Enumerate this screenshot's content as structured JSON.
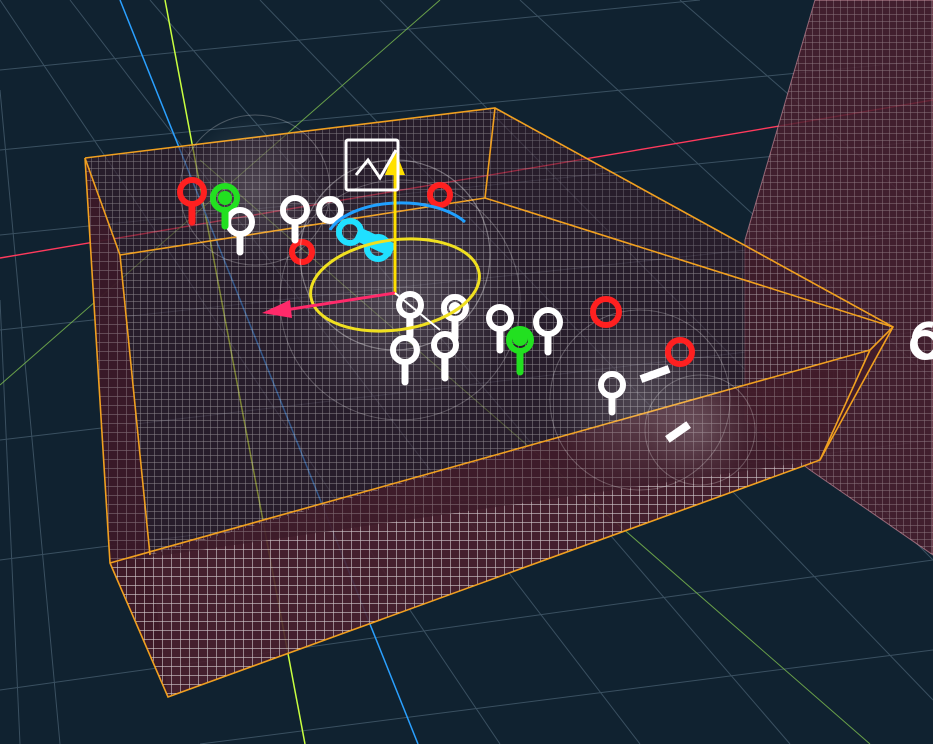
{
  "scene": {
    "type": "3d-editor-viewport",
    "background_color": "#102230",
    "grid_color": "#3f5566",
    "selection_outline_color": "#f0a020",
    "volume_grid_color": "#ffffff",
    "volume_fill_color": "#4a1f2e",
    "axis_colors": {
      "x": "#ff3a5c",
      "y": "#c8ff40",
      "z": "#2aa0ff"
    }
  },
  "gizmo": {
    "rotate_ring_color": "#f0e020",
    "move_arrow_up_color": "#ffe000",
    "move_arrow_left_color": "#ff2a6a"
  },
  "light_icons": {
    "colors": [
      "#ff2020",
      "#22e020",
      "#20e0ff",
      "#ffffff"
    ]
  }
}
